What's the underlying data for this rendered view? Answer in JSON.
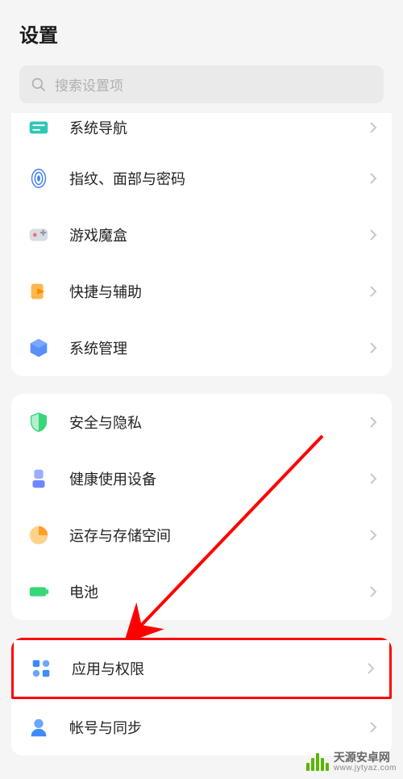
{
  "header": {
    "title": "设置"
  },
  "search": {
    "placeholder": "搜索设置项"
  },
  "group1": {
    "items": [
      {
        "label": "系统导航",
        "icon": "nav-icon",
        "color": "#2ec7b6"
      },
      {
        "label": "指纹、面部与密码",
        "icon": "fingerprint-icon",
        "color": "#3d7eff"
      },
      {
        "label": "游戏魔盒",
        "icon": "gamebox-icon",
        "color": "#a0a6b0"
      },
      {
        "label": "快捷与辅助",
        "icon": "shortcut-icon",
        "color": "#ff9f2a"
      },
      {
        "label": "系统管理",
        "icon": "system-icon",
        "color": "#3d7eff"
      }
    ]
  },
  "group2": {
    "items": [
      {
        "label": "安全与隐私",
        "icon": "shield-icon",
        "color": "#37d67a"
      },
      {
        "label": "健康使用设备",
        "icon": "health-icon",
        "color": "#7a8cff"
      },
      {
        "label": "运存与存储空间",
        "icon": "storage-icon",
        "color": "#ffac3a"
      },
      {
        "label": "电池",
        "icon": "battery-icon",
        "color": "#37d67a"
      }
    ]
  },
  "group3": {
    "items": [
      {
        "label": "应用与权限",
        "icon": "apps-icon",
        "color": "#3d8bff",
        "highlighted": true
      },
      {
        "label": "帐号与同步",
        "icon": "account-icon",
        "color": "#3d8bff"
      }
    ]
  },
  "annotation": {
    "arrow_color": "#ff0000",
    "highlight_color": "#ff0000"
  },
  "watermark": {
    "main": "天源安卓网",
    "sub": "www.jytyaz.com"
  }
}
